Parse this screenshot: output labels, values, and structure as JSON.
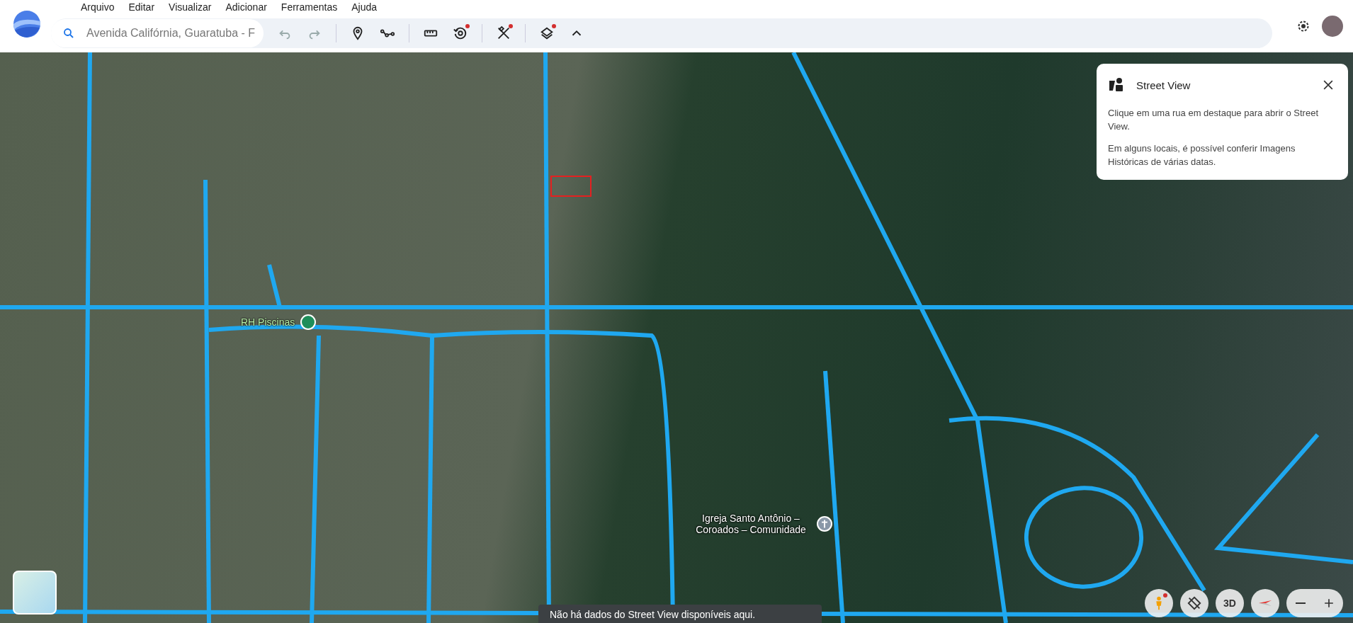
{
  "menu": [
    "Arquivo",
    "Editar",
    "Visualizar",
    "Adicionar",
    "Ferramentas",
    "Ajuda"
  ],
  "search": {
    "value": "Avenida Califórnia, Guaratuba - F"
  },
  "toolbar": [
    {
      "kind": "undo",
      "disabled": true,
      "badge": false
    },
    {
      "kind": "redo",
      "disabled": true,
      "badge": false
    },
    {
      "kind": "placemark",
      "disabled": false,
      "badge": false
    },
    {
      "kind": "path",
      "disabled": false,
      "badge": false
    },
    {
      "kind": "ruler",
      "disabled": false,
      "badge": false
    },
    {
      "kind": "history",
      "disabled": false,
      "badge": true
    },
    {
      "kind": "tools",
      "disabled": false,
      "badge": true
    },
    {
      "kind": "layers",
      "disabled": false,
      "badge": true
    },
    {
      "kind": "collapse",
      "disabled": false,
      "badge": false
    }
  ],
  "street_view_panel": {
    "title": "Street View",
    "paragraphs": [
      "Clique em uma rua em destaque para abrir o Street View.",
      "Em alguns locais, é possível conferir Imagens Históricas de várias datas."
    ]
  },
  "map_labels": [
    {
      "kind": "place",
      "text": "RH Piscinas"
    },
    {
      "kind": "church",
      "text": "Igreja Santo Antônio – Coroados – Comunidade"
    }
  ],
  "toast": "Não há dados do Street View disponíveis aqui.",
  "map_controls": {
    "view_3d": "3D",
    "pegman_badge": true
  }
}
